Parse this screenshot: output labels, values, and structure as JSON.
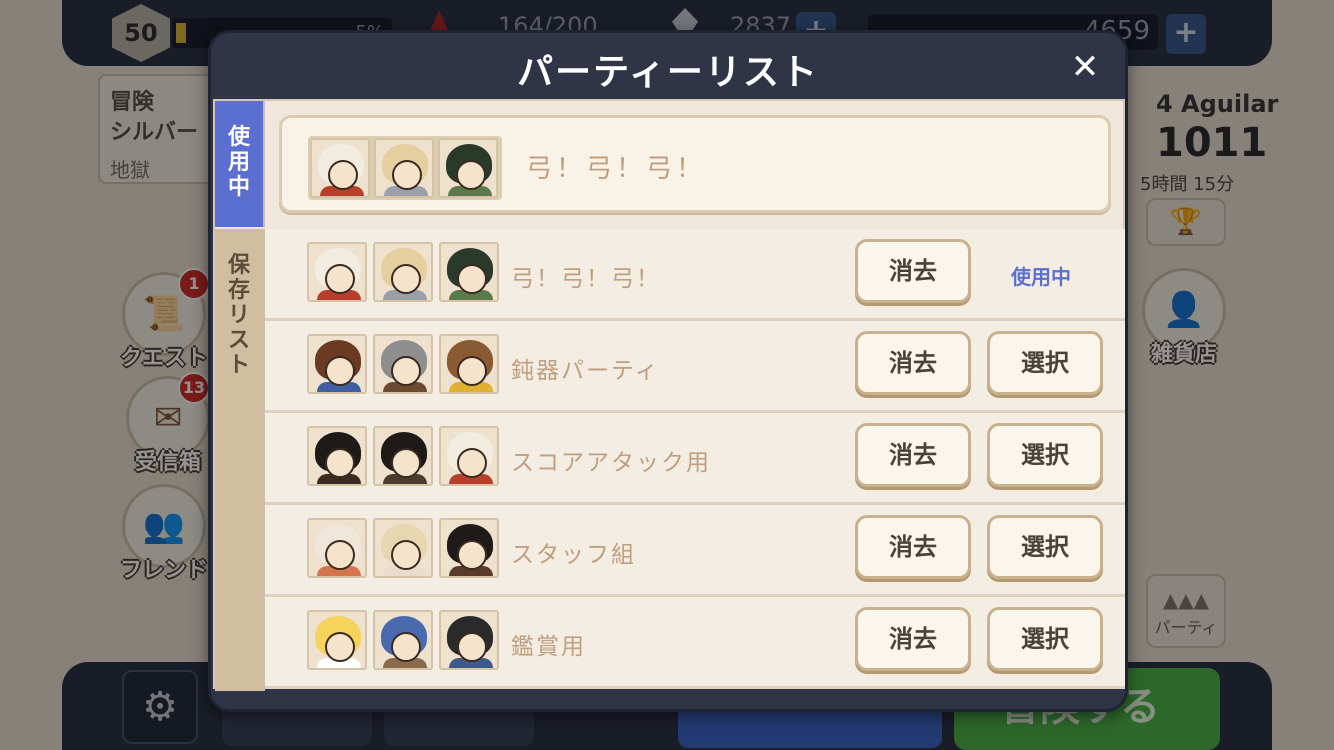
{
  "background": {
    "level": "50",
    "exp_text": "5%",
    "stamina_text": "164/200",
    "crystal_text": "2837",
    "feather_text": "4659",
    "plus_label": "+",
    "adventure": {
      "title": "冒険",
      "sub": "シルバー",
      "difficulty": "地獄"
    },
    "quest_label": "クエスト",
    "quest_badge": "1",
    "inbox_label": "受信箱",
    "inbox_badge": "13",
    "friend_label": "フレンド",
    "rank": "4 Aguilar",
    "score": "1011",
    "time": "5時間 15分",
    "shop_label": "雑貨店",
    "party_label": "パーティ",
    "start_label": "冒険する"
  },
  "modal": {
    "title": "パーティーリスト",
    "close_label": "✕",
    "tab_in_use": [
      "使",
      "用",
      "中"
    ],
    "tab_saved": [
      "保",
      "存",
      "リ",
      "ス",
      "ト"
    ],
    "current": {
      "name": "弓！弓！弓！",
      "portraits": [
        {
          "hair": "#f3ece1",
          "body": "#b8402b"
        },
        {
          "hair": "#e6cf9f",
          "body": "#9aa0a8"
        },
        {
          "hair": "#2a3a2a",
          "body": "#5b7a4a"
        }
      ]
    },
    "delete_label": "消去",
    "select_label": "選択",
    "in_use_label": "使用中",
    "rows": [
      {
        "name": "弓！弓！弓！",
        "in_use": true,
        "portraits": [
          {
            "hair": "#f3ece1",
            "body": "#b8402b"
          },
          {
            "hair": "#e6cf9f",
            "body": "#9aa0a8"
          },
          {
            "hair": "#2a3a2a",
            "body": "#5b7a4a"
          }
        ]
      },
      {
        "name": "鈍器パーティ",
        "in_use": false,
        "portraits": [
          {
            "hair": "#6a3a22",
            "body": "#3f5fa0"
          },
          {
            "hair": "#8e8e8e",
            "body": "#6b4a32"
          },
          {
            "hair": "#8a5a32",
            "body": "#e0b030"
          }
        ]
      },
      {
        "name": "スコアアタック用",
        "in_use": false,
        "portraits": [
          {
            "hair": "#1e1a18",
            "body": "#3a2a22"
          },
          {
            "hair": "#1e1a18",
            "body": "#4a3a30"
          },
          {
            "hair": "#f3ece1",
            "body": "#b8402b"
          }
        ]
      },
      {
        "name": "スタッフ組",
        "in_use": false,
        "portraits": [
          {
            "hair": "#f1e6da",
            "body": "#d6744e"
          },
          {
            "hair": "#e8d6b0",
            "body": "#e8dccc"
          },
          {
            "hair": "#1e1a18",
            "body": "#5a3a2a"
          }
        ]
      },
      {
        "name": "鑑賞用",
        "in_use": false,
        "portraits": [
          {
            "hair": "#f6d35a",
            "body": "#ffffff"
          },
          {
            "hair": "#4a6ab0",
            "body": "#8a6a4a"
          },
          {
            "hair": "#2a2a2a",
            "body": "#3a5a8a"
          }
        ]
      }
    ]
  }
}
